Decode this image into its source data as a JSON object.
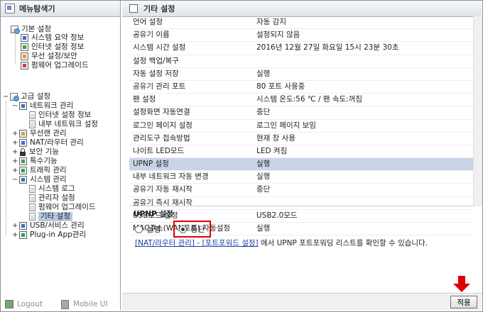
{
  "menu_panel": {
    "title": "메뉴탐색기",
    "basic_group": "기본 설정",
    "basic_items": [
      "시스템 요약 정보",
      "인터넷 설정 정보",
      "무선 설정/보안",
      "펌웨어 업그레이드"
    ],
    "advanced_group": "고급 설정",
    "network_group": "네트워크 관리",
    "network_items": [
      "인터넷 설정 정보",
      "내부 네트워크 설정"
    ],
    "advanced_items": [
      "무선랜 관리",
      "NAT/라우터 관리",
      "보안 기능",
      "특수기능",
      "트래픽 관리"
    ],
    "system_group": "시스템 관리",
    "system_items": [
      "시스템 로그",
      "관리자 설정",
      "펌웨어 업그레이드",
      "기타 설정"
    ],
    "usb_item": "USB/서비스 관리",
    "plugin_item": "Plug-in App관리",
    "logout": "Logout",
    "mobile_ui": "Mobile UI"
  },
  "main": {
    "title": "기타 설정",
    "rows": [
      {
        "label": "언어 설정",
        "value": "자동 감지"
      },
      {
        "label": "공유기 이름",
        "value": "설정되지 않음"
      },
      {
        "label": "시스템 시간 설정",
        "value": "2016년 12월 27일 화요일 15시 23분 30초"
      },
      {
        "label": "설정 백업/복구",
        "value": ""
      },
      {
        "label": "자동 설정 저장",
        "value": "실행"
      },
      {
        "label": "공유기 관리 포트",
        "value": "80 포트 사용중"
      },
      {
        "label": "팬 설정",
        "value": "시스템 온도:56 ℃ / 팬 속도:꺼짐"
      },
      {
        "label": "설정화면 자동연결",
        "value": "중단"
      },
      {
        "label": "로그인 페이지 설정",
        "value": "로그인 페이지 보임"
      },
      {
        "label": "관리도구 접속방법",
        "value": "현재 창 사용"
      },
      {
        "label": "나이트 LED모드",
        "value": "LED 켜짐"
      },
      {
        "label": "UPNP 설정",
        "value": "실행"
      },
      {
        "label": "내부 네트워크 자동 변경",
        "value": "실행"
      },
      {
        "label": "공유기 자동 재시작",
        "value": "중단"
      },
      {
        "label": "공유기 즉시 재시작",
        "value": ""
      },
      {
        "label": "USB모드 설정",
        "value": "USB2.0모드"
      },
      {
        "label": "MAC주소(WAN포트) 자동설정",
        "value": "실행"
      }
    ],
    "section_title": "UPNP 설정",
    "radio_run": "실행",
    "radio_stop": "중단",
    "selected": "중단",
    "link_text": "[NAT/라우터 관리] - [포트포워드 설정]",
    "info_text": " 에서 UPNP 포트포워딩 리스트를 확인할 수 있습니다.",
    "apply_label": "적용"
  },
  "colors": {
    "highlight_row": "#c9d5e6",
    "selected_tree": "#b7c9e2",
    "callout_red": "#e00000",
    "link": "#1b3fa8"
  }
}
